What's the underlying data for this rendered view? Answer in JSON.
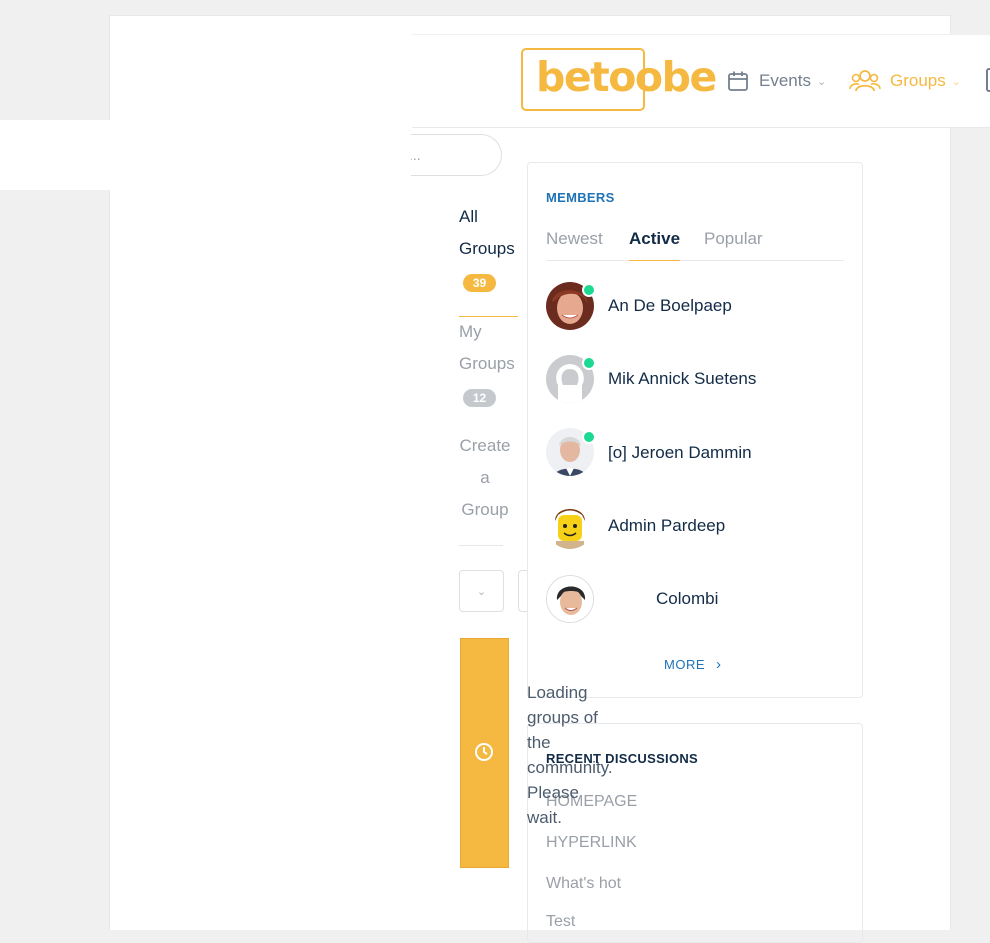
{
  "header": {
    "logo_text": "betoobe",
    "nav": [
      {
        "label": "Events",
        "icon": "calendar-icon"
      },
      {
        "label": "Groups",
        "icon": "users-icon",
        "active": true
      }
    ],
    "accent_color": "#f5b941"
  },
  "search": {
    "placeholder": "..."
  },
  "group_tabs": {
    "all": {
      "label_line1": "All",
      "label_line2": "Groups",
      "count": "39"
    },
    "my": {
      "label_line1": "My",
      "label_line2": "Groups",
      "count": "12"
    },
    "create": {
      "label_line1": "Create",
      "label_line2": "a",
      "label_line3": "Group"
    }
  },
  "view_toggle": {
    "grid_icon": "grid-icon",
    "list_icon": "list-icon"
  },
  "loading": {
    "icon": "clock-icon",
    "text": "Loading groups of the community. Please wait."
  },
  "members_widget": {
    "title": "MEMBERS",
    "tabs": [
      "Newest",
      "Active",
      "Popular"
    ],
    "active_tab": "Active",
    "members": [
      {
        "name": "An De Boelpaep",
        "online": true
      },
      {
        "name": "Mik Annick Suetens",
        "online": true
      },
      {
        "name": "[o] Jeroen Dammin",
        "online": true
      },
      {
        "name": "Admin Pardeep",
        "online": false
      },
      {
        "name": "Colombi",
        "online": false
      }
    ],
    "more_label": "MORE"
  },
  "discussions_widget": {
    "title": "RECENT DISCUSSIONS",
    "items": [
      "HOMEPAGE",
      "HYPERLINK",
      "What's hot",
      "Test"
    ]
  }
}
